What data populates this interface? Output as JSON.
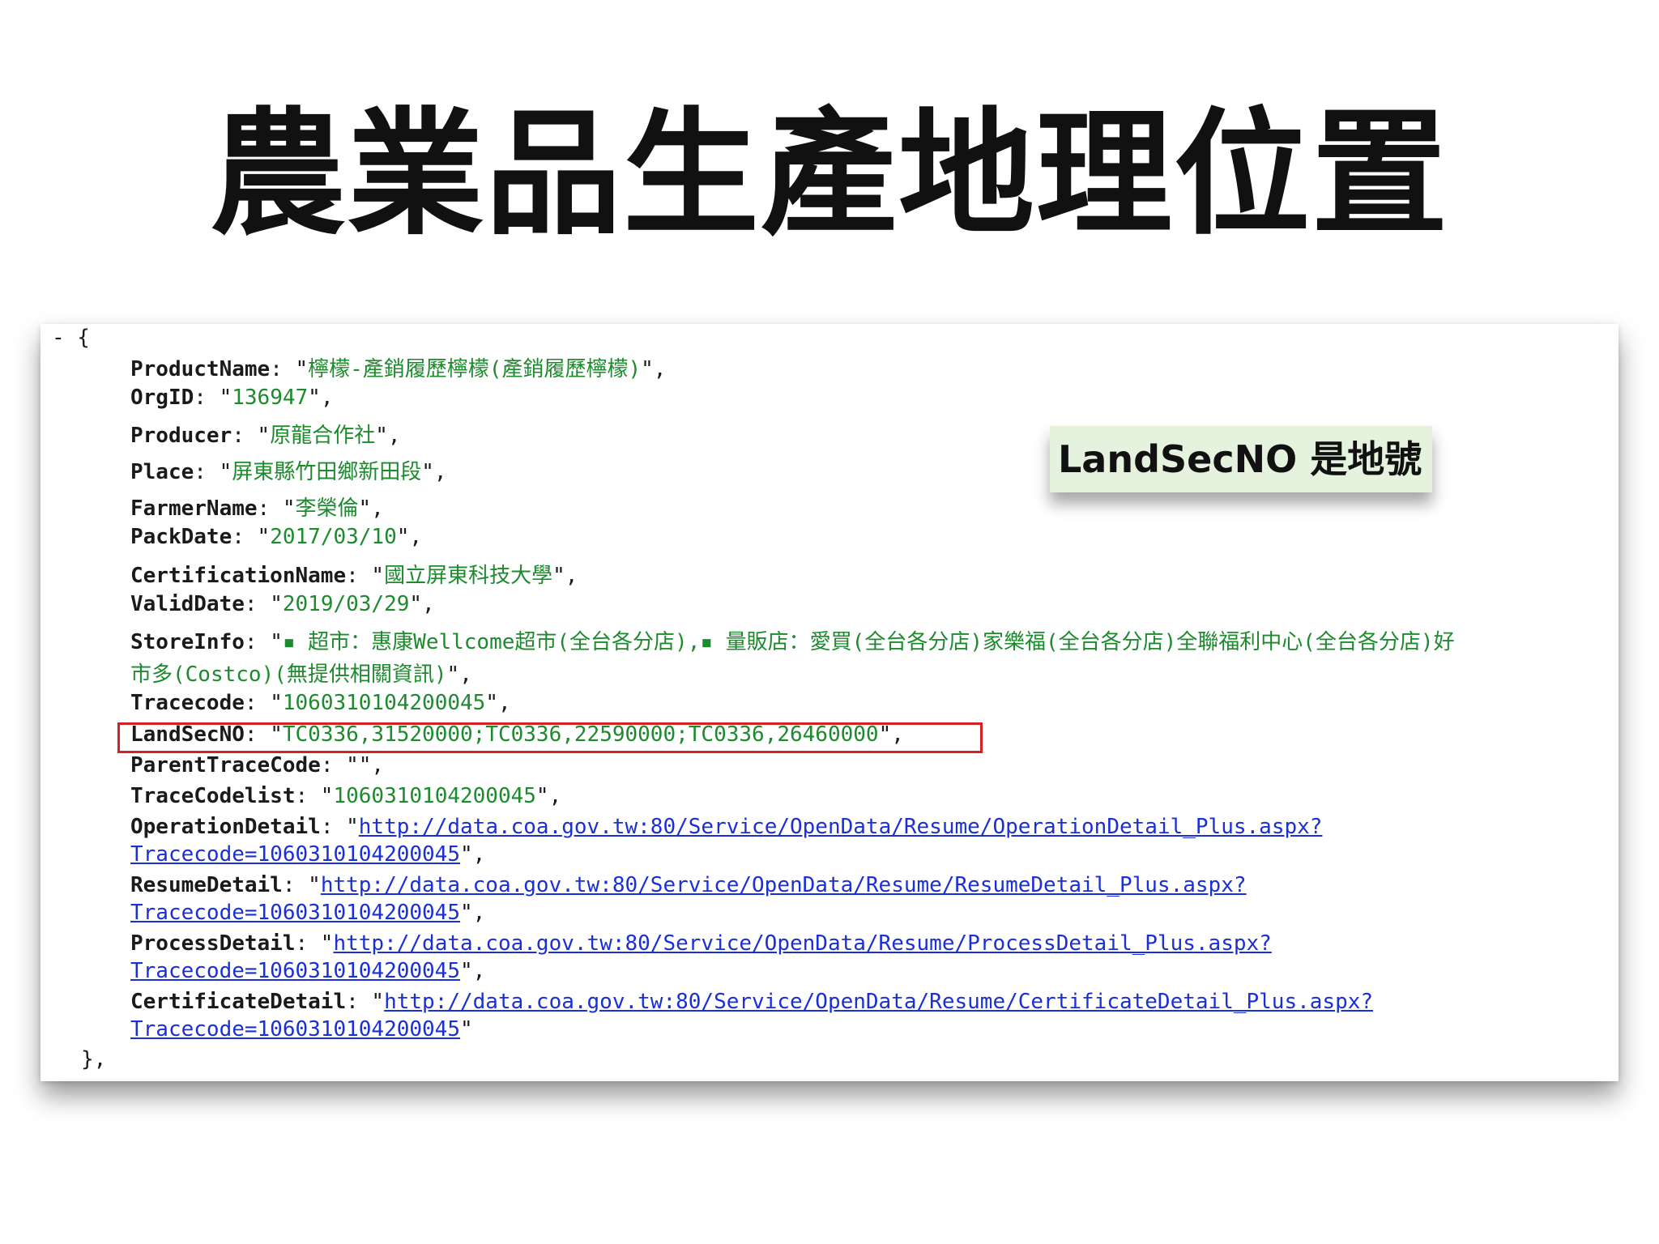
{
  "slide": {
    "title": "農業品生產地理位置"
  },
  "json_view": {
    "open_line": "- {",
    "fields": [
      {
        "key": "ProductName",
        "value": "檸檬-產銷履歷檸檬(產銷履歷檸檬)"
      },
      {
        "key": "OrgID",
        "value": "136947"
      },
      {
        "key": "Producer",
        "value": "原龍合作社"
      },
      {
        "key": "Place",
        "value": "屏東縣竹田鄉新田段"
      },
      {
        "key": "FarmerName",
        "value": "李榮倫"
      },
      {
        "key": "PackDate",
        "value": "2017/03/10"
      },
      {
        "key": "CertificationName",
        "value": "國立屏東科技大學"
      },
      {
        "key": "ValidDate",
        "value": "2019/03/29"
      },
      {
        "key": "StoreInfo",
        "value_line1": "▪ 超市：惠康Wellcome超市(全台各分店),▪ 量販店：愛買(全台各分店)家樂福(全台各分店)全聯福利中心(全台各分店)好",
        "value_line2": "市多(Costco)(無提供相關資訊)"
      },
      {
        "key": "Tracecode",
        "value": "1060310104200045"
      },
      {
        "key": "LandSecNO",
        "value": "TC0336,31520000;TC0336,22590000;TC0336,26460000"
      },
      {
        "key": "ParentTraceCode",
        "value": ""
      },
      {
        "key": "TraceCodelist",
        "value": "1060310104200045"
      },
      {
        "key": "OperationDetail",
        "url_line1": "http://data.coa.gov.tw:80/Service/OpenData/Resume/OperationDetail_Plus.aspx?",
        "url_line2": "Tracecode=1060310104200045"
      },
      {
        "key": "ResumeDetail",
        "url_line1": "http://data.coa.gov.tw:80/Service/OpenData/Resume/ResumeDetail_Plus.aspx?",
        "url_line2": "Tracecode=1060310104200045"
      },
      {
        "key": "ProcessDetail",
        "url_line1": "http://data.coa.gov.tw:80/Service/OpenData/Resume/ProcessDetail_Plus.aspx?",
        "url_line2": "Tracecode=1060310104200045"
      },
      {
        "key": "CertificateDetail",
        "url_line1": "http://data.coa.gov.tw:80/Service/OpenData/Resume/CertificateDetail_Plus.aspx?",
        "url_line2": "Tracecode=1060310104200045"
      }
    ],
    "close_line": "},"
  },
  "callout": {
    "text": "LandSecNO 是地號"
  },
  "colors": {
    "key": "#1a1a1a",
    "string": "#1e8a2e",
    "link": "#1a2fd6",
    "highlight_border": "#d42222",
    "callout_bg": "#e4f2de"
  }
}
